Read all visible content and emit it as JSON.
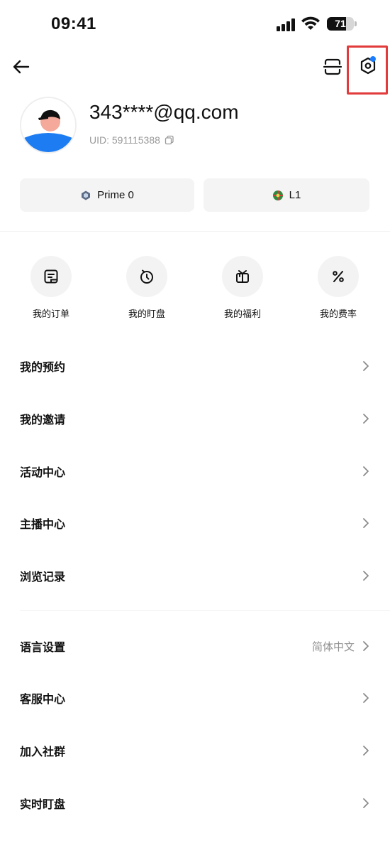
{
  "status_bar": {
    "time": "09:41",
    "battery_level": "71",
    "icons": [
      "signal-icon",
      "wifi-icon",
      "battery-icon"
    ]
  },
  "header": {
    "back_icon": "arrow-left-icon",
    "scan_icon": "scan-icon",
    "settings_icon": "hexagon-settings-icon",
    "settings_has_dot": true,
    "highlight_color": "#e23b3b"
  },
  "profile": {
    "email": "343****@qq.com",
    "uid": "UID: 591115388",
    "copy_icon": "copy-icon"
  },
  "badges": [
    {
      "label": "Prime 0",
      "icon": "prime-hexagon-icon"
    },
    {
      "label": "L1",
      "icon": "globe-level-icon"
    }
  ],
  "quick_actions": [
    {
      "label": "我的订单",
      "icon": "order-icon"
    },
    {
      "label": "我的盯盘",
      "icon": "timer-icon"
    },
    {
      "label": "我的福利",
      "icon": "gift-icon"
    },
    {
      "label": "我的费率",
      "icon": "percent-icon"
    }
  ],
  "menu": [
    {
      "label": "我的预约"
    },
    {
      "label": "我的邀请"
    },
    {
      "label": "活动中心"
    },
    {
      "label": "主播中心"
    },
    {
      "label": "浏览记录"
    }
  ],
  "settings_menu": [
    {
      "label": "语言设置",
      "value": "简体中文"
    },
    {
      "label": "客服中心"
    },
    {
      "label": "加入社群"
    },
    {
      "label": "实时盯盘"
    }
  ],
  "colors": {
    "accent_dot": "#1a7cff",
    "chip_background": "#f4f4f4",
    "secondary_text": "#9a9a9a"
  }
}
